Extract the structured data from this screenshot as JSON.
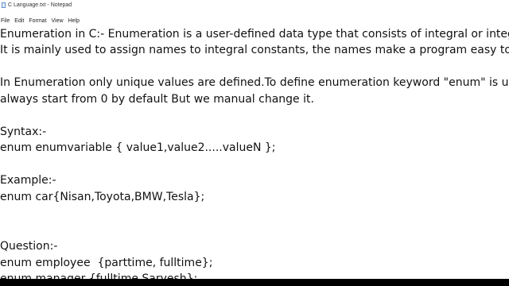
{
  "window": {
    "title": "C Language.txt - Notepad"
  },
  "menu": {
    "items": [
      {
        "id": "file",
        "label": "File"
      },
      {
        "id": "edit",
        "label": "Edit"
      },
      {
        "id": "format",
        "label": "Format"
      },
      {
        "id": "view",
        "label": "View"
      },
      {
        "id": "help",
        "label": "Help"
      }
    ]
  },
  "document": {
    "lines": [
      "Enumeration in C:- Enumeration is a user-defined data type that consists of integral or integer constants.",
      "It is mainly used to assign names to integral constants, the names make a program easy to read and maintain.",
      "In Enumeration only unique values are defined.To define enumeration keyword \"enum\" is used. Its values",
      "always start from 0 by default But we manual change it.",
      "Syntax:-",
      "enum enumvariable { value1,value2.....valueN };",
      "Example:-",
      "enum car{Nisan,Toyota,BMW,Tesla};",
      "Question:-",
      "enum employee  {parttime, fulltime};",
      "enum manager {fulltime,Sarvesh};"
    ]
  }
}
